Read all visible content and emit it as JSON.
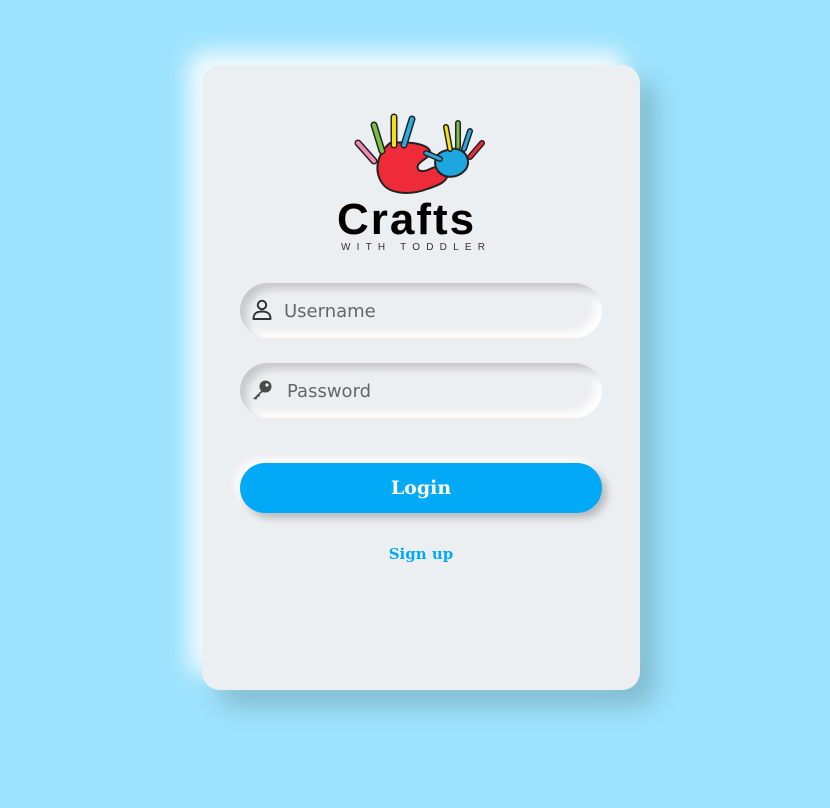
{
  "colors": {
    "background": "#9de3fd",
    "card": "#eceff2",
    "accent": "#02a9f7"
  },
  "logo": {
    "brand": "Crafts",
    "tagline": "WITH TODDLER",
    "icon": "handprints-logo"
  },
  "form": {
    "username": {
      "placeholder": "Username",
      "value": "",
      "icon": "user-icon"
    },
    "password": {
      "placeholder": "Password",
      "value": "",
      "icon": "key-icon"
    },
    "login_label": "Login",
    "signup_label": "Sign up"
  }
}
